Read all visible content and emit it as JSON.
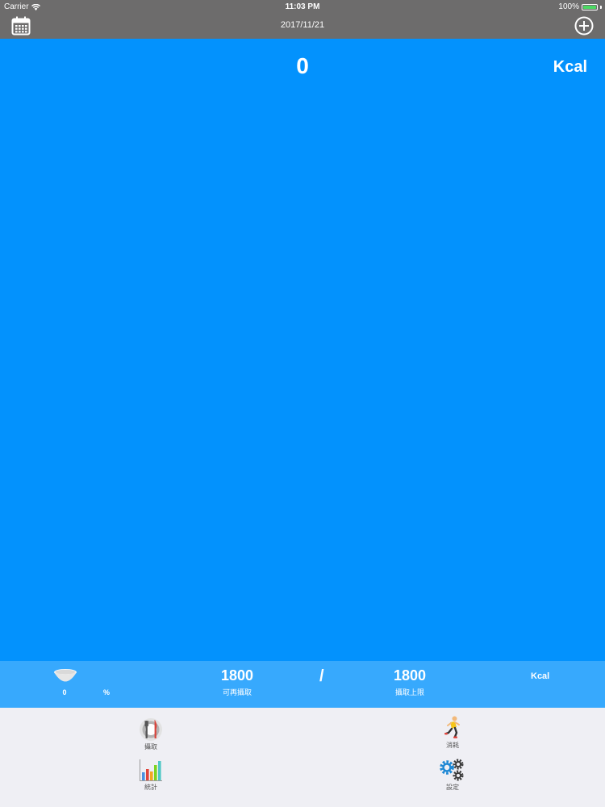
{
  "status_bar": {
    "carrier": "Carrier",
    "time": "11:03 PM",
    "battery": "100%",
    "battery_level": 1.0
  },
  "nav": {
    "title": "2017/11/21",
    "left_icon": "calendar-icon",
    "right_icon": "plus-circle-icon"
  },
  "main": {
    "kcal_value": "0",
    "kcal_unit": "Kcal"
  },
  "summary": {
    "percent_value": "0",
    "percent_unit": "%",
    "remaining_value": "1800",
    "remaining_label": "可再攝取",
    "separator": "/",
    "limit_value": "1800",
    "limit_label": "攝取上限",
    "unit": "Kcal"
  },
  "tabs": {
    "intake": "攝取",
    "burn": "消耗",
    "stats": "統計",
    "settings": "設定"
  },
  "colors": {
    "bar": "#6d6c6c",
    "main": "#0392fd",
    "summary": "#37a9fd",
    "tabbar": "#efeff4"
  }
}
